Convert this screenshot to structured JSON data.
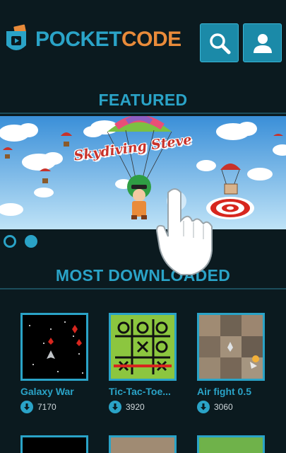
{
  "header": {
    "brand_part1": "POCKET",
    "brand_part2": "CODE",
    "logo_icon": "pocket-code-logo-icon",
    "search_icon": "search-icon",
    "profile_icon": "profile-icon"
  },
  "featured": {
    "title": "FEATURED",
    "banner_title": "Skydiving Steve",
    "pager": {
      "total": 2,
      "active": 2
    }
  },
  "most_downloaded": {
    "title": "MOST DOWNLOADED",
    "projects": [
      {
        "name": "Galaxy War",
        "downloads": "7170"
      },
      {
        "name": "Tic-Tac-Toe...",
        "downloads": "3920"
      },
      {
        "name": "Air fight 0.5",
        "downloads": "3060"
      }
    ]
  },
  "colors": {
    "accent": "#2aa3c7",
    "brand_orange": "#e98b3a",
    "background": "#0b1a1f"
  }
}
